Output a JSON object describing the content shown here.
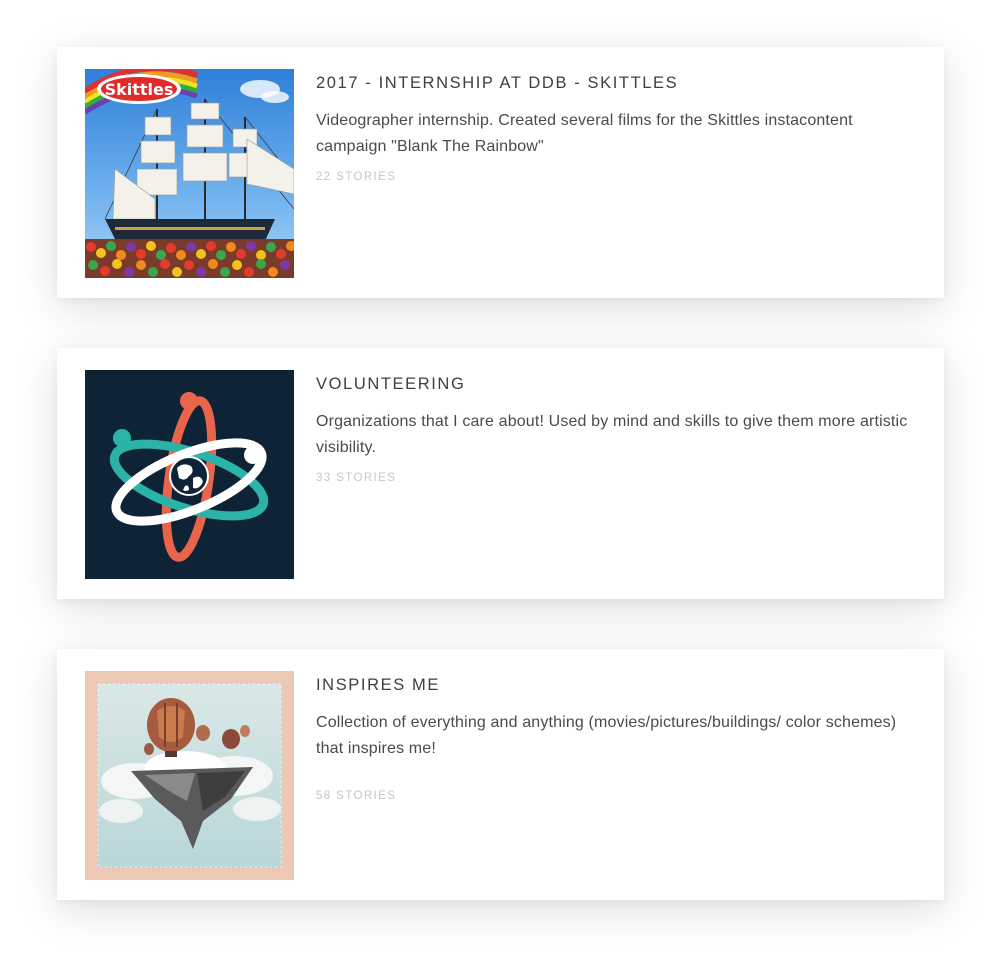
{
  "collections": [
    {
      "title": "2017 - INTERNSHIP AT DDB - SKITTLES",
      "description": "Videographer internship. Created several films for the Skittles instacontent campaign \"Blank The Rainbow\"",
      "stories": "22 STORIES",
      "thumb_logo_text": "Skittles",
      "thumb_icon": "skittles-ship-image"
    },
    {
      "title": "VOLUNTEERING",
      "description": "Organizations that I care about! Used by mind and skills to give them more artistic visibility.",
      "stories": "33 STORIES",
      "thumb_icon": "atom-globe-logo",
      "thumb_bg": "#0f2337"
    },
    {
      "title": "INSPIRES ME",
      "description": "Collection of everything and anything (movies/pictures/buildings/ color schemes) that inspires me!",
      "stories": "58 STORIES",
      "thumb_icon": "hot-air-balloon-island-image"
    }
  ]
}
